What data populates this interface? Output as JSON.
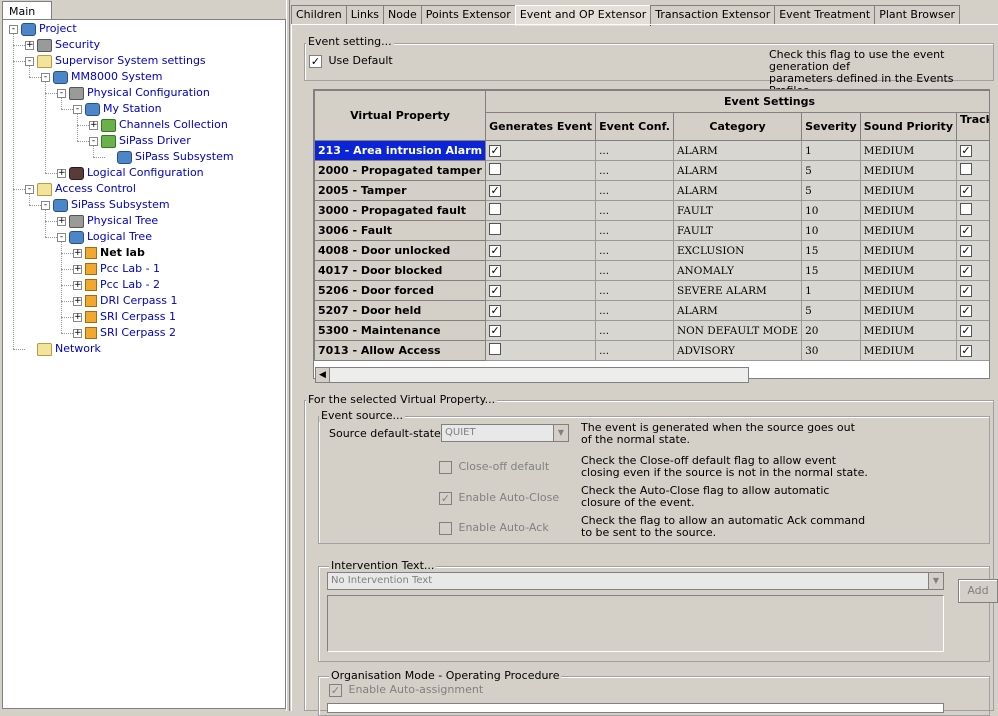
{
  "left_tab": "Main",
  "tree": [
    {
      "id": "project",
      "label": "Project",
      "level": 0,
      "exp": "-",
      "icon": "blue",
      "sel": false
    },
    {
      "id": "security",
      "label": "Security",
      "level": 1,
      "exp": "+",
      "icon": "gray",
      "sel": false
    },
    {
      "id": "supervisor",
      "label": "Supervisor System settings",
      "level": 1,
      "exp": "-",
      "icon": "folder",
      "sel": false
    },
    {
      "id": "mm8000",
      "label": "MM8000 System",
      "level": 2,
      "exp": "-",
      "icon": "blue",
      "sel": false
    },
    {
      "id": "physconf",
      "label": "Physical Configuration",
      "level": 3,
      "exp": "-",
      "icon": "gray",
      "sel": false
    },
    {
      "id": "mystation",
      "label": "My Station",
      "level": 4,
      "exp": "-",
      "icon": "blue",
      "sel": false
    },
    {
      "id": "channels",
      "label": "Channels Collection",
      "level": 5,
      "exp": "+",
      "icon": "green",
      "sel": false
    },
    {
      "id": "sipassdrv",
      "label": "SiPass Driver",
      "level": 5,
      "exp": "-",
      "icon": "green",
      "sel": false
    },
    {
      "id": "sipasssub1",
      "label": "SiPass Subsystem",
      "level": 6,
      "exp": "",
      "icon": "blue",
      "sel": false
    },
    {
      "id": "logconf",
      "label": "Logical Configuration",
      "level": 3,
      "exp": "+",
      "icon": "dark",
      "sel": false
    },
    {
      "id": "access",
      "label": "Access Control",
      "level": 1,
      "exp": "-",
      "icon": "folder",
      "sel": false
    },
    {
      "id": "sipasssub2",
      "label": "SiPass Subsystem",
      "level": 2,
      "exp": "-",
      "icon": "blue",
      "sel": false
    },
    {
      "id": "phystree",
      "label": "Physical Tree",
      "level": 3,
      "exp": "+",
      "icon": "gray",
      "sel": false
    },
    {
      "id": "logtree",
      "label": "Logical Tree",
      "level": 3,
      "exp": "-",
      "icon": "blue",
      "sel": false
    },
    {
      "id": "netlab",
      "label": "Net lab",
      "level": 4,
      "exp": "+",
      "icon": "box",
      "sel": true
    },
    {
      "id": "pcc1",
      "label": "Pcc Lab - 1",
      "level": 4,
      "exp": "+",
      "icon": "box",
      "sel": false
    },
    {
      "id": "pcc2",
      "label": "Pcc Lab - 2",
      "level": 4,
      "exp": "+",
      "icon": "box",
      "sel": false
    },
    {
      "id": "dri",
      "label": "DRI Cerpass 1",
      "level": 4,
      "exp": "+",
      "icon": "box",
      "sel": false
    },
    {
      "id": "sri1",
      "label": "SRI Cerpass 1",
      "level": 4,
      "exp": "+",
      "icon": "box",
      "sel": false
    },
    {
      "id": "sri2",
      "label": "SRI Cerpass 2",
      "level": 4,
      "exp": "+",
      "icon": "box",
      "sel": false
    },
    {
      "id": "network",
      "label": "Network",
      "level": 1,
      "exp": "",
      "icon": "folder",
      "sel": false
    }
  ],
  "tabs": [
    "Children",
    "Links",
    "Node",
    "Points Extensor",
    "Event and OP Extensor",
    "Transaction Extensor",
    "Event Treatment",
    "Plant Browser"
  ],
  "active_tab": 4,
  "event_setting": {
    "group_label": "Event setting...",
    "use_default_label": "Use Default",
    "use_default_checked": true,
    "help_line1": "Check this flag to use the event generation def",
    "help_line2": "parameters defined in the Events Profiles."
  },
  "grid": {
    "col_virtual_property": "Virtual Property",
    "group_header": "Event Settings",
    "columns": [
      "Generates Event",
      "Event Conf.",
      "Category",
      "Severity",
      "Sound Priority",
      "Track in Histor"
    ],
    "ellipsis": "...",
    "rows": [
      {
        "vp": "213 - Area intrusion Alarm",
        "gen": true,
        "cat": "ALARM",
        "sev": "1",
        "snd": "MEDIUM",
        "track": true
      },
      {
        "vp": "2000 - Propagated tamper",
        "gen": false,
        "cat": "ALARM",
        "sev": "5",
        "snd": "MEDIUM",
        "track": false
      },
      {
        "vp": "2005 - Tamper",
        "gen": true,
        "cat": "ALARM",
        "sev": "5",
        "snd": "MEDIUM",
        "track": true
      },
      {
        "vp": "3000 - Propagated fault",
        "gen": false,
        "cat": "FAULT",
        "sev": "10",
        "snd": "MEDIUM",
        "track": false
      },
      {
        "vp": "3006 - Fault",
        "gen": false,
        "cat": "FAULT",
        "sev": "10",
        "snd": "MEDIUM",
        "track": true
      },
      {
        "vp": "4008 - Door unlocked",
        "gen": true,
        "cat": "EXCLUSION",
        "sev": "15",
        "snd": "MEDIUM",
        "track": true
      },
      {
        "vp": "4017 - Door blocked",
        "gen": true,
        "cat": "ANOMALY",
        "sev": "15",
        "snd": "MEDIUM",
        "track": true
      },
      {
        "vp": "5206 - Door forced",
        "gen": true,
        "cat": "SEVERE ALARM",
        "sev": "1",
        "snd": "MEDIUM",
        "track": true
      },
      {
        "vp": "5207 - Door held",
        "gen": true,
        "cat": "ALARM",
        "sev": "5",
        "snd": "MEDIUM",
        "track": true
      },
      {
        "vp": "5300 - Maintenance",
        "gen": true,
        "cat": "NON DEFAULT MODE",
        "sev": "20",
        "snd": "MEDIUM",
        "track": true
      },
      {
        "vp": "7013 - Allow Access",
        "gen": false,
        "cat": "ADVISORY",
        "sev": "30",
        "snd": "MEDIUM",
        "track": true
      }
    ]
  },
  "selected_vp": {
    "group_label": "For the selected Virtual Property...",
    "event_source_label": "Event source...",
    "source_default_state_label": "Source default-state:",
    "source_default_state_value": "QUIET",
    "source_note1": "The event is generated when the source goes out",
    "source_note2": "of the normal state.",
    "closeoff_label": "Close-off default",
    "closeoff_checked": false,
    "closeoff_note1": "Check the Close-off default flag to allow event",
    "closeoff_note2": "closing even if the source is not in the normal state.",
    "autoclose_label": "Enable Auto-Close",
    "autoclose_checked": true,
    "autoclose_note1": "Check the Auto-Close flag to allow automatic",
    "autoclose_note2": "closure of the event.",
    "autoack_label": "Enable Auto-Ack",
    "autoack_checked": false,
    "autoack_note1": "Check the flag to allow an automatic Ack command",
    "autoack_note2": "to be sent to the source."
  },
  "intervention": {
    "group_label": "Intervention Text...",
    "dropdown_value": "No Intervention Text",
    "add_button": "Add"
  },
  "organisation": {
    "group_label": "Organisation Mode - Operating Procedure",
    "auto_assign_label": "Enable Auto-assignment",
    "auto_assign_checked": true
  }
}
